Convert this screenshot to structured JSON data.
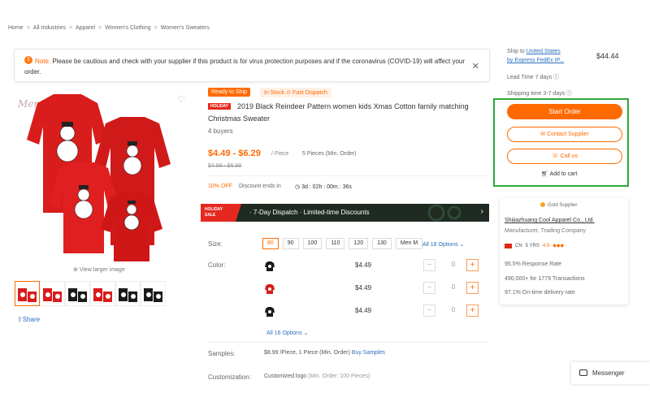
{
  "breadcrumb": [
    "Home",
    "All Industries",
    "Apparel",
    "Women's Clothing",
    "Women's Sweaters"
  ],
  "notice": {
    "label": "Note:",
    "text": "Please be cautious and check with your supplier if this product is for virus protection purposes and if the coronavirus (COVID-19) will affect your order."
  },
  "gallery": {
    "view_larger": "View larger image",
    "share": "Share",
    "watermark": "Merry Sweet"
  },
  "product": {
    "badge_ready": "Ready to Ship",
    "badge_stock": "In Stock  ⊙ Fast Dispatch",
    "holiday_tag": "HOLIDAY",
    "title": "2019 Black Reindeer Pattern women kids Xmas Cotton family matching Christmas Sweater",
    "buyers": "4 buyers",
    "price": "$4.49 - $6.29",
    "per_piece": "/ Piece",
    "moq": "5 Pieces (Min. Order)",
    "orig_price": "$4.99 - $6.99",
    "discount": "10% OFF",
    "discount_ends": "Discount ends in",
    "timer": "3d : 02h : 00m : 36s"
  },
  "holiday_bar": {
    "sale_line1": "HOLIDAY",
    "sale_line2": "SALE",
    "text": "· 7-Day Dispatch  · Limited-time Discounts"
  },
  "size": {
    "label": "Size:",
    "options": [
      "80",
      "90",
      "100",
      "110",
      "120",
      "130",
      "Men M"
    ],
    "all_link": "All 18 Options"
  },
  "color": {
    "label": "Color:",
    "rows": [
      {
        "price": "$4.49",
        "qty": "0",
        "swatch": "#1a1a1a"
      },
      {
        "price": "$4.49",
        "qty": "0",
        "swatch": "#d91c1c"
      },
      {
        "price": "$4.49",
        "qty": "0",
        "swatch": "#1a1a1a"
      }
    ],
    "all_link": "All 16 Options"
  },
  "samples": {
    "label": "Samples:",
    "value": "$8.99 /Piece, 1 Piece (Min. Order) ",
    "link": "Buy Samples"
  },
  "customization": {
    "label": "Customization:",
    "value": "Customized logo ",
    "note": "(Min. Order: 100 Pieces)"
  },
  "shipping": {
    "ship_to_prefix": "Ship to ",
    "ship_to_link": "United States",
    "by_link": "by Express FedEx IP...",
    "price": "$44.44",
    "lead_time": "Lead Time 7 days ⓘ",
    "ship_time": "Shipping time 3-7 days ⓘ"
  },
  "actions": {
    "start_order": "Start Order",
    "contact": "Contact Supplier",
    "call": "Call us",
    "add_cart": "Add to cart"
  },
  "supplier": {
    "gold": "Gold Supplier",
    "name": "Shijiazhuang Cool Apparel Co., Ltd.",
    "type": "Manufacturer, Trading Company",
    "country": "CN",
    "years": "5 YRS",
    "rating": "4.9",
    "response_rate": "95.5% Response Rate",
    "transactions": "490,000+ for 1779 Transactions",
    "on_time": "97.1% On-time delivery rate"
  },
  "messenger": "Messenger",
  "colors": {
    "accent": "#ff6a00",
    "link": "#2a6ebb",
    "highlight": "#2eaa3c"
  }
}
